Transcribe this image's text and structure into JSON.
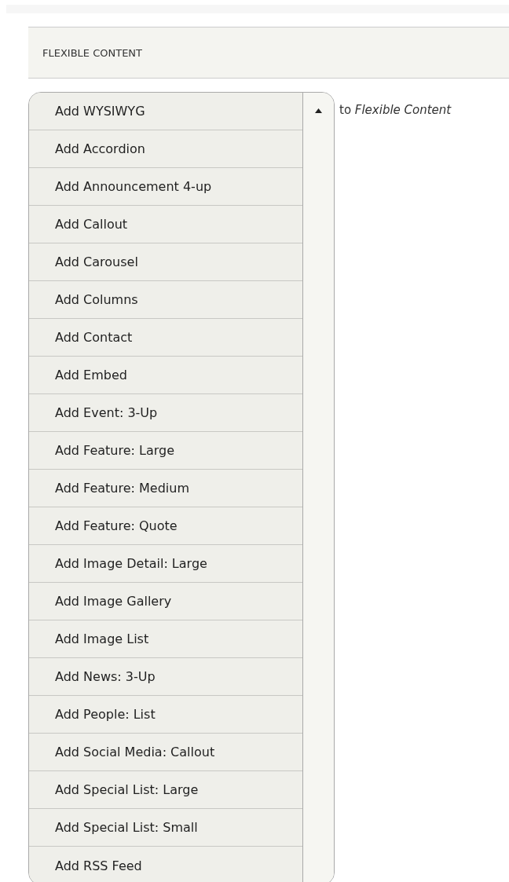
{
  "section": {
    "title": "FLEXIBLE CONTENT"
  },
  "add_menu": {
    "items": [
      {
        "label": "Add WYSIWYG"
      },
      {
        "label": "Add Accordion"
      },
      {
        "label": "Add Announcement 4-up"
      },
      {
        "label": "Add Callout"
      },
      {
        "label": "Add Carousel"
      },
      {
        "label": "Add Columns"
      },
      {
        "label": "Add Contact"
      },
      {
        "label": "Add Embed"
      },
      {
        "label": "Add Event: 3-Up"
      },
      {
        "label": "Add Feature: Large"
      },
      {
        "label": "Add Feature: Medium"
      },
      {
        "label": "Add Feature: Quote"
      },
      {
        "label": "Add Image Detail: Large"
      },
      {
        "label": "Add Image Gallery"
      },
      {
        "label": "Add Image List"
      },
      {
        "label": "Add News: 3-Up"
      },
      {
        "label": "Add People: List"
      },
      {
        "label": "Add Social Media: Callout"
      },
      {
        "label": "Add Special List: Large"
      },
      {
        "label": "Add Special List: Small"
      },
      {
        "label": "Add RSS Feed"
      }
    ],
    "suffix": "to *Flexible Content*"
  }
}
